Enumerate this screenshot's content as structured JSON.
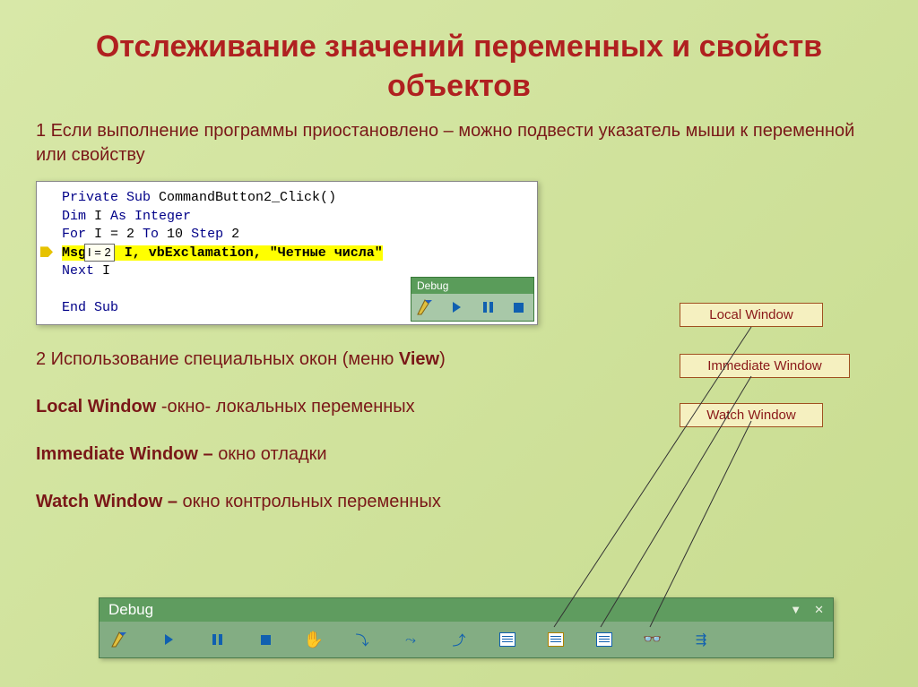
{
  "title": "Отслеживание значений переменных и свойств объектов",
  "point1": "1 Если выполнение программы приостановлено – можно подвести указатель мыши к переменной или свойству",
  "code": {
    "l1a": "Private Sub",
    "l1b": " CommandButton2_Click()",
    "l2a": "Dim ",
    "l2b": "I ",
    "l2c": "As Integer",
    "l3a": "For ",
    "l3b": "I = 2 ",
    "l3c": "To ",
    "l3d": "10 ",
    "l3e": "Step ",
    "l3f": "2",
    "l4a": "Msg",
    "tooltip": "I = 2",
    "l4b": " I, vbExclamation, \"Четные числа\"",
    "l5": "Next ",
    "l5b": "I",
    "l6": "End Sub"
  },
  "mini_debug_title": "Debug",
  "labels": {
    "local": "Local Window",
    "immediate": "Immediate Window",
    "watch": "Watch Window"
  },
  "section2": {
    "intro_a": "2 Использование специальных окон (меню ",
    "intro_b": "View",
    "intro_c": ")",
    "local_a": "Local Window ",
    "local_b": "-окно- локальных переменных",
    "imm_a": "Immediate Window – ",
    "imm_b": "окно отладки",
    "watch_a": "Watch Window – ",
    "watch_b": "окно контрольных переменных"
  },
  "toolbar_title": "Debug"
}
